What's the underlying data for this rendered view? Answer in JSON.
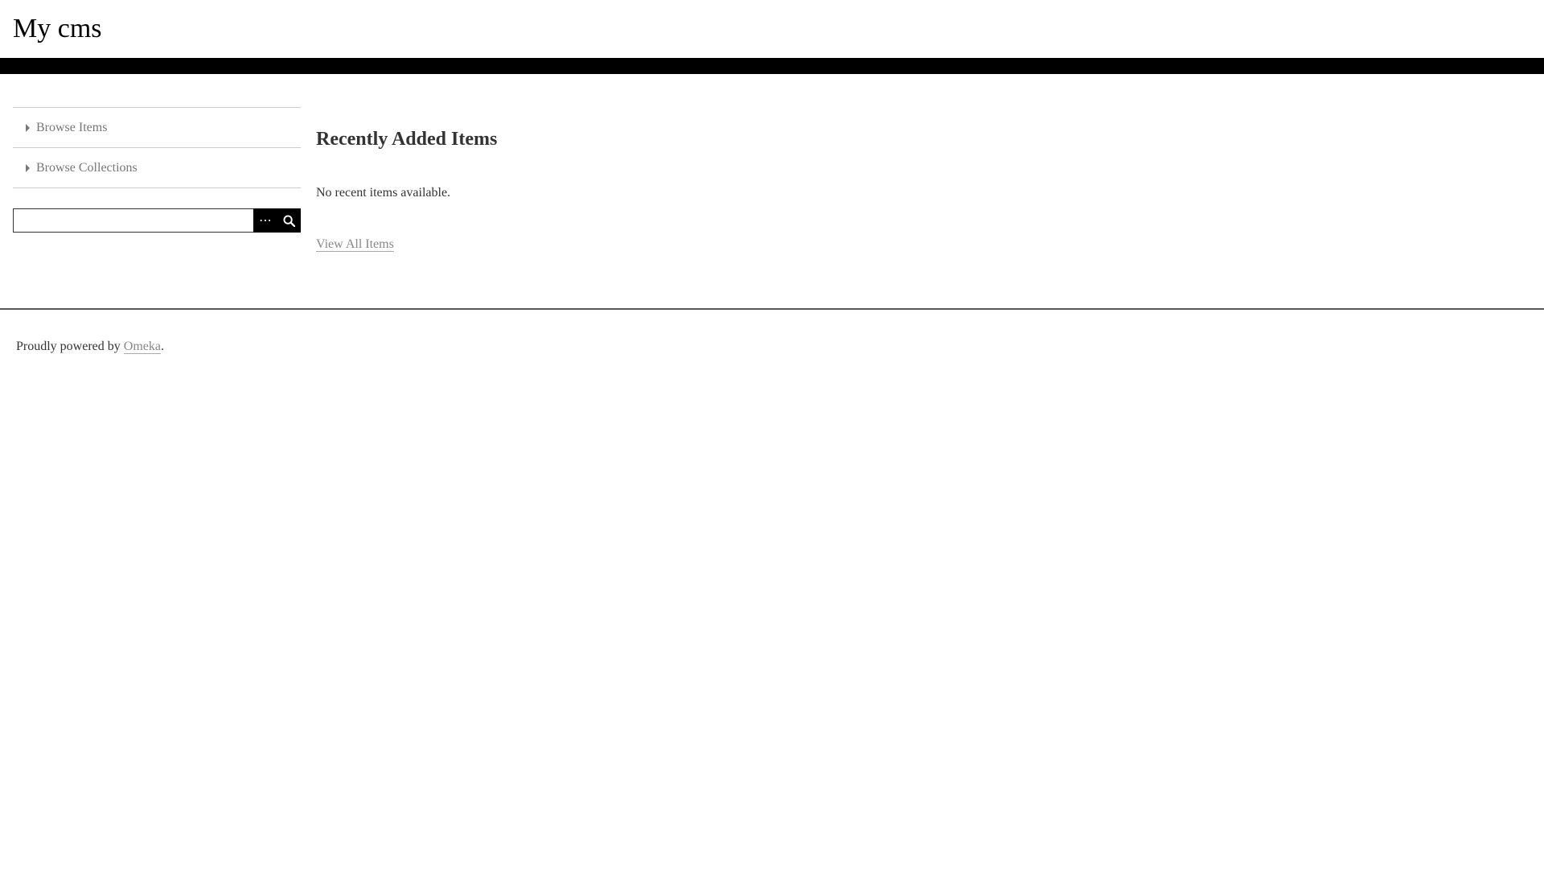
{
  "header": {
    "site_title": "My cms"
  },
  "sidebar": {
    "nav_items": [
      {
        "label": "Browse Items",
        "icon": "caret-right-icon"
      },
      {
        "label": "Browse Collections",
        "icon": "caret-right-icon"
      }
    ],
    "search": {
      "value": "",
      "placeholder": "",
      "options_icon": "ellipsis-icon",
      "submit_icon": "search-icon",
      "options_label": "⋯"
    }
  },
  "main": {
    "section_title": "Recently Added Items",
    "empty_message": "No recent items available.",
    "view_all_label": "View All Items"
  },
  "footer": {
    "prefix": "Proudly powered by ",
    "link_label": "Omeka",
    "suffix": "."
  },
  "colors": {
    "bar": "#000000",
    "link": "#888888",
    "text": "#333333"
  }
}
